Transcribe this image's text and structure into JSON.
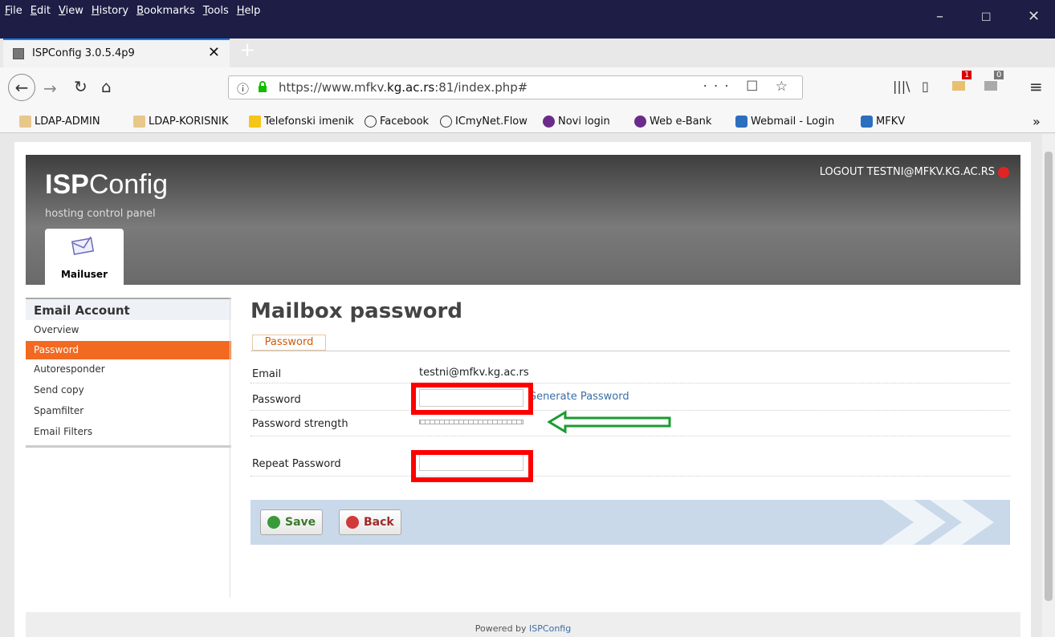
{
  "browser": {
    "menu": [
      "File",
      "Edit",
      "View",
      "History",
      "Bookmarks",
      "Tools",
      "Help"
    ],
    "tab_title": "ISPConfig 3.0.5.4p9",
    "url_prefix": "https://www.mfkv.",
    "url_domain": "kg.ac.rs",
    "url_suffix": ":81/index.php#",
    "url_actions": "··· ☐ ☆",
    "toolbar_badge_1": "1",
    "toolbar_badge_2": "0"
  },
  "bookmarks": [
    {
      "label": "LDAP-ADMIN",
      "icon": "grid-icon"
    },
    {
      "label": "LDAP-KORISNIK",
      "icon": "grid-icon"
    },
    {
      "label": "Telefonski imenik",
      "icon": "folder-icon"
    },
    {
      "label": "Facebook",
      "icon": "globe-icon"
    },
    {
      "label": "ICmyNet.Flow",
      "icon": "globe-icon"
    },
    {
      "label": "Novi login",
      "icon": "planet-icon"
    },
    {
      "label": "Web e-Bank",
      "icon": "planet-icon"
    },
    {
      "label": "Webmail - Login",
      "icon": "roundcube-icon"
    },
    {
      "label": "MFKV",
      "icon": "roundcube-icon"
    }
  ],
  "header": {
    "logo_bold": "ISP",
    "logo_rest": "Config",
    "tagline": "hosting control panel",
    "logout": "LOGOUT TESTNI@MFKV.KG.AC.RS",
    "module_tab": "Mailuser"
  },
  "sidebar": {
    "title": "Email Account",
    "items": [
      "Overview",
      "Password",
      "Autoresponder",
      "Send copy",
      "Spamfilter",
      "Email Filters"
    ],
    "active": "Password"
  },
  "main": {
    "title": "Mailbox password",
    "subtab": "Password",
    "email_label": "Email",
    "email_value": "testni@mfkv.kg.ac.rs",
    "password_label": "Password",
    "password_value": "",
    "generate_link": "Generate Password",
    "strength_label": "Password strength",
    "repeat_label": "Repeat Password",
    "repeat_value": "",
    "save_label": "Save",
    "back_label": "Back"
  },
  "footer": {
    "prefix": "Powered by ",
    "brand": "ISPConfig"
  },
  "colors": {
    "active_menu": "#f26a21",
    "annotation_box": "#ff0000",
    "annotation_arrow": "#1a9b32"
  }
}
